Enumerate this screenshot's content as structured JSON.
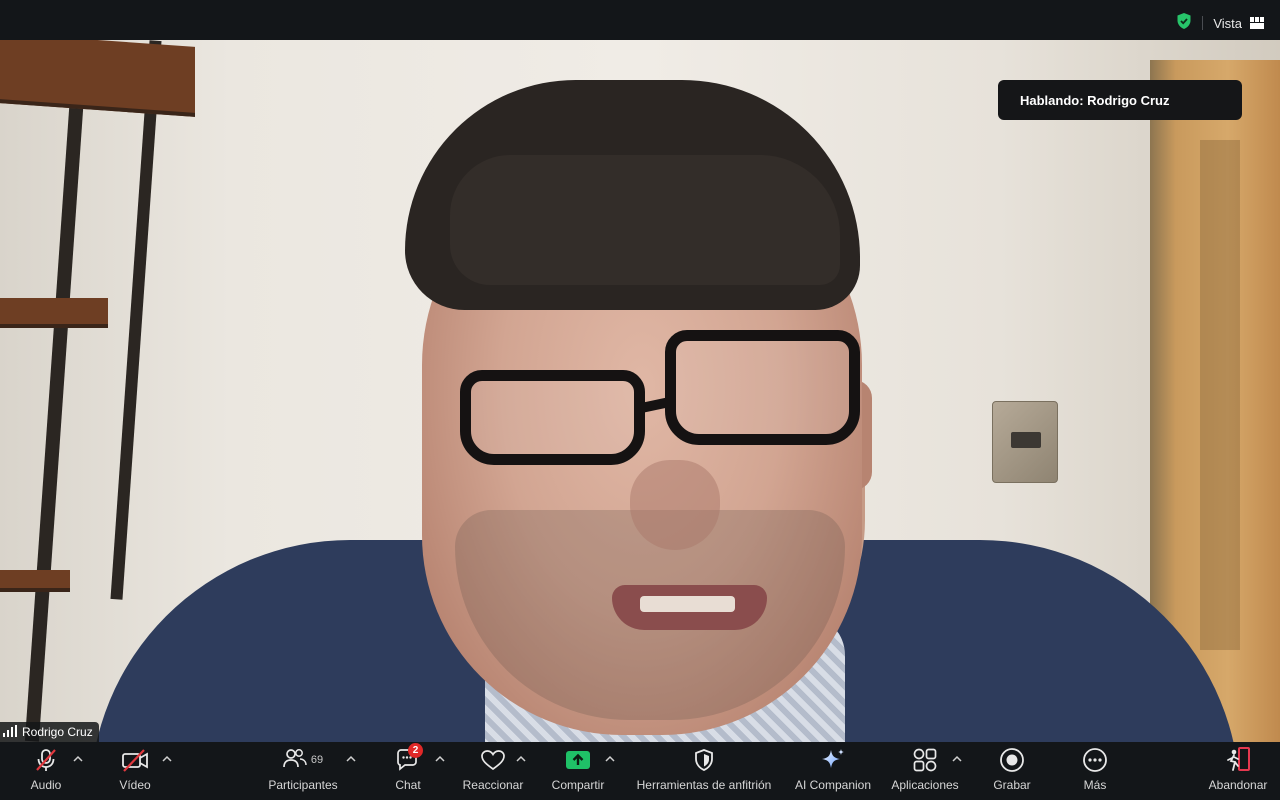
{
  "titlebar": {
    "view_label": "Vista",
    "security_icon": "shield-check-icon",
    "view_icon": "grid-view-icon"
  },
  "video": {
    "speaking_label": "Hablando: Rodrigo Cruz",
    "participant_name": "Rodrigo Cruz"
  },
  "toolbar": {
    "audio_label": "Audio",
    "video_label": "Vídeo",
    "participants_label": "Participantes",
    "participants_count": "69",
    "chat_label": "Chat",
    "chat_badge": "2",
    "react_label": "Reaccionar",
    "share_label": "Compartir",
    "host_tools_label": "Herramientas de anfitrión",
    "ai_label": "AI Companion",
    "apps_label": "Aplicaciones",
    "record_label": "Grabar",
    "more_label": "Más",
    "leave_label": "Abandonar"
  },
  "colors": {
    "toolbar_bg": "#131619",
    "share_green": "#1fc167",
    "leave_red": "#e5384f",
    "muted_red": "#e0383e",
    "shield_green": "#27c46a"
  }
}
